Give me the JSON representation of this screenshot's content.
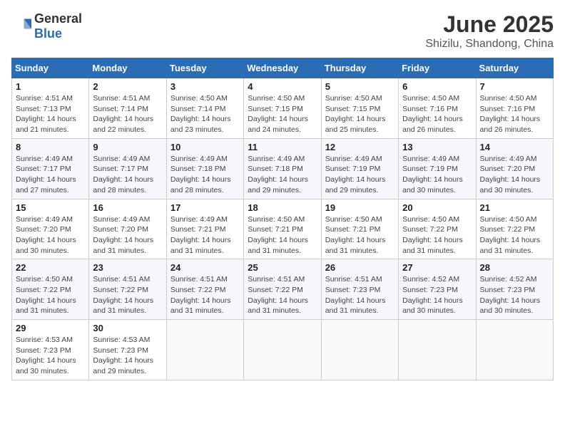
{
  "header": {
    "logo_general": "General",
    "logo_blue": "Blue",
    "month_title": "June 2025",
    "location": "Shizilu, Shandong, China"
  },
  "weekdays": [
    "Sunday",
    "Monday",
    "Tuesday",
    "Wednesday",
    "Thursday",
    "Friday",
    "Saturday"
  ],
  "weeks": [
    [
      {
        "day": "1",
        "sunrise": "4:51 AM",
        "sunset": "7:13 PM",
        "daylight": "14 hours and 21 minutes."
      },
      {
        "day": "2",
        "sunrise": "4:51 AM",
        "sunset": "7:14 PM",
        "daylight": "14 hours and 22 minutes."
      },
      {
        "day": "3",
        "sunrise": "4:50 AM",
        "sunset": "7:14 PM",
        "daylight": "14 hours and 23 minutes."
      },
      {
        "day": "4",
        "sunrise": "4:50 AM",
        "sunset": "7:15 PM",
        "daylight": "14 hours and 24 minutes."
      },
      {
        "day": "5",
        "sunrise": "4:50 AM",
        "sunset": "7:15 PM",
        "daylight": "14 hours and 25 minutes."
      },
      {
        "day": "6",
        "sunrise": "4:50 AM",
        "sunset": "7:16 PM",
        "daylight": "14 hours and 26 minutes."
      },
      {
        "day": "7",
        "sunrise": "4:50 AM",
        "sunset": "7:16 PM",
        "daylight": "14 hours and 26 minutes."
      }
    ],
    [
      {
        "day": "8",
        "sunrise": "4:49 AM",
        "sunset": "7:17 PM",
        "daylight": "14 hours and 27 minutes."
      },
      {
        "day": "9",
        "sunrise": "4:49 AM",
        "sunset": "7:17 PM",
        "daylight": "14 hours and 28 minutes."
      },
      {
        "day": "10",
        "sunrise": "4:49 AM",
        "sunset": "7:18 PM",
        "daylight": "14 hours and 28 minutes."
      },
      {
        "day": "11",
        "sunrise": "4:49 AM",
        "sunset": "7:18 PM",
        "daylight": "14 hours and 29 minutes."
      },
      {
        "day": "12",
        "sunrise": "4:49 AM",
        "sunset": "7:19 PM",
        "daylight": "14 hours and 29 minutes."
      },
      {
        "day": "13",
        "sunrise": "4:49 AM",
        "sunset": "7:19 PM",
        "daylight": "14 hours and 30 minutes."
      },
      {
        "day": "14",
        "sunrise": "4:49 AM",
        "sunset": "7:20 PM",
        "daylight": "14 hours and 30 minutes."
      }
    ],
    [
      {
        "day": "15",
        "sunrise": "4:49 AM",
        "sunset": "7:20 PM",
        "daylight": "14 hours and 30 minutes."
      },
      {
        "day": "16",
        "sunrise": "4:49 AM",
        "sunset": "7:20 PM",
        "daylight": "14 hours and 31 minutes."
      },
      {
        "day": "17",
        "sunrise": "4:49 AM",
        "sunset": "7:21 PM",
        "daylight": "14 hours and 31 minutes."
      },
      {
        "day": "18",
        "sunrise": "4:50 AM",
        "sunset": "7:21 PM",
        "daylight": "14 hours and 31 minutes."
      },
      {
        "day": "19",
        "sunrise": "4:50 AM",
        "sunset": "7:21 PM",
        "daylight": "14 hours and 31 minutes."
      },
      {
        "day": "20",
        "sunrise": "4:50 AM",
        "sunset": "7:22 PM",
        "daylight": "14 hours and 31 minutes."
      },
      {
        "day": "21",
        "sunrise": "4:50 AM",
        "sunset": "7:22 PM",
        "daylight": "14 hours and 31 minutes."
      }
    ],
    [
      {
        "day": "22",
        "sunrise": "4:50 AM",
        "sunset": "7:22 PM",
        "daylight": "14 hours and 31 minutes."
      },
      {
        "day": "23",
        "sunrise": "4:51 AM",
        "sunset": "7:22 PM",
        "daylight": "14 hours and 31 minutes."
      },
      {
        "day": "24",
        "sunrise": "4:51 AM",
        "sunset": "7:22 PM",
        "daylight": "14 hours and 31 minutes."
      },
      {
        "day": "25",
        "sunrise": "4:51 AM",
        "sunset": "7:22 PM",
        "daylight": "14 hours and 31 minutes."
      },
      {
        "day": "26",
        "sunrise": "4:51 AM",
        "sunset": "7:23 PM",
        "daylight": "14 hours and 31 minutes."
      },
      {
        "day": "27",
        "sunrise": "4:52 AM",
        "sunset": "7:23 PM",
        "daylight": "14 hours and 30 minutes."
      },
      {
        "day": "28",
        "sunrise": "4:52 AM",
        "sunset": "7:23 PM",
        "daylight": "14 hours and 30 minutes."
      }
    ],
    [
      {
        "day": "29",
        "sunrise": "4:53 AM",
        "sunset": "7:23 PM",
        "daylight": "14 hours and 30 minutes."
      },
      {
        "day": "30",
        "sunrise": "4:53 AM",
        "sunset": "7:23 PM",
        "daylight": "14 hours and 29 minutes."
      },
      null,
      null,
      null,
      null,
      null
    ]
  ]
}
